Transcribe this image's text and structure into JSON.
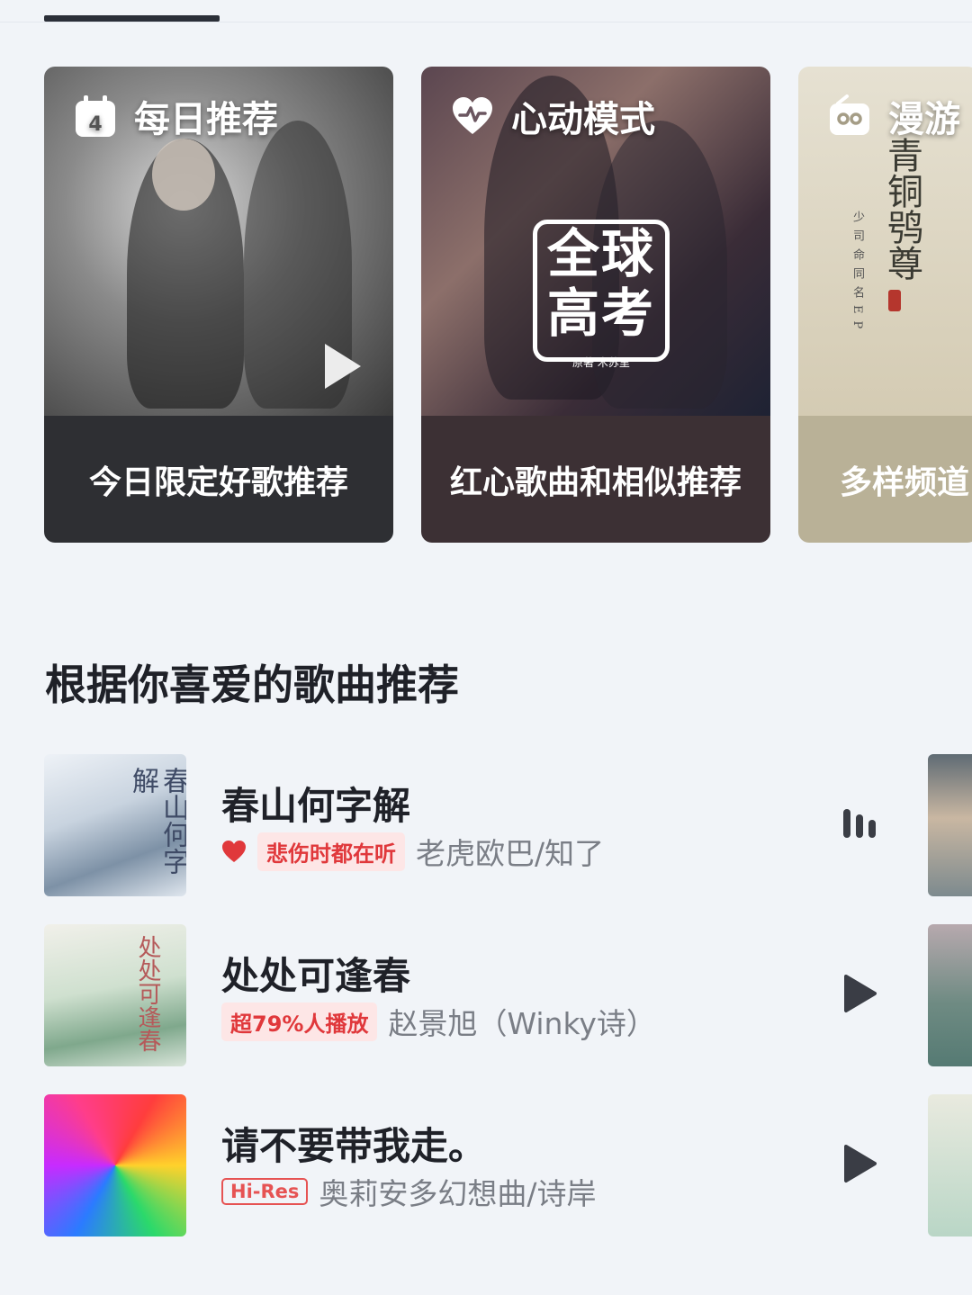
{
  "header": {
    "active_tab_indicator": true
  },
  "cards": [
    {
      "title": "每日推荐",
      "icon": "calendar-icon",
      "icon_badge": "4",
      "subtitle": "今日限定好歌推荐"
    },
    {
      "title": "心动模式",
      "icon": "heart-pulse-icon",
      "subtitle": "红心歌曲和相似推荐",
      "art_text": "全球\n高考",
      "art_sub": "原著 木苏里"
    },
    {
      "title": "漫游",
      "icon": "radio-icon",
      "subtitle": "多样频道",
      "art_title": "青铜鸮尊",
      "art_sub": "少司命同名EP"
    }
  ],
  "section": {
    "title": "根据你喜爱的歌曲推荐"
  },
  "songs": [
    {
      "title": "春山何字解",
      "tag": "悲伤时都在听",
      "tag_style": "red",
      "has_heart": true,
      "artist": "老虎欧巴/知了",
      "control": "playing-bars-icon",
      "cover_text": "春山何字解"
    },
    {
      "title": "处处可逢春",
      "tag": "超79%人播放",
      "tag_style": "red",
      "has_heart": false,
      "artist": "赵景旭（Winky诗）",
      "control": "play-icon",
      "cover_text": "处处可逢春"
    },
    {
      "title": "请不要带我走。",
      "tag": "Hi-Res",
      "tag_style": "outline",
      "has_heart": false,
      "artist": "奥莉安多幻想曲/诗岸",
      "control": "play-icon"
    }
  ],
  "colors": {
    "background": "#f1f4f8",
    "accent_red": "#e0383b",
    "text_primary": "#1f2128",
    "text_secondary": "#7a7e86"
  }
}
